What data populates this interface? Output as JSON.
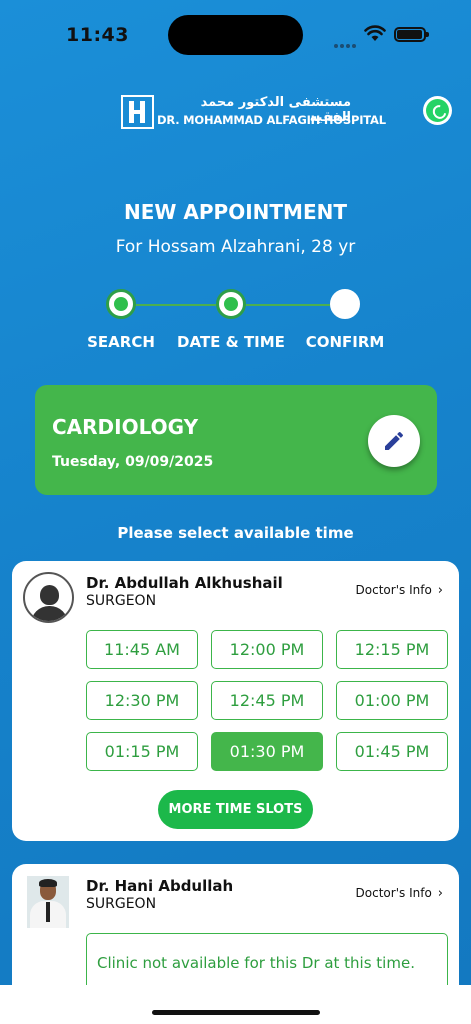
{
  "status": {
    "time": "11:43"
  },
  "logo": {
    "arabic": "مستشفى الدكتور محمد الفقيه",
    "english": "DR. MOHAMMAD ALFAGIH HOSPITAL"
  },
  "header": {
    "title": "NEW APPOINTMENT",
    "subtitle": "For Hossam Alzahrani, 28 yr"
  },
  "steps": [
    {
      "label": "SEARCH",
      "state": "done"
    },
    {
      "label": "DATE & TIME",
      "state": "done"
    },
    {
      "label": "CONFIRM",
      "state": "pending"
    }
  ],
  "specialty": {
    "name": "CARDIOLOGY",
    "date": "Tuesday, 09/09/2025"
  },
  "prompt": "Please select available time",
  "doctors": [
    {
      "name": "Dr. Abdullah Alkhushail",
      "role": "SURGEON",
      "info_label": "Doctor's Info",
      "slots": [
        "11:45 AM",
        "12:00 PM",
        "12:15 PM",
        "12:30 PM",
        "12:45 PM",
        "01:00 PM",
        "01:15 PM",
        "01:30 PM",
        "01:45 PM"
      ],
      "selected_slot": "01:30 PM",
      "more_label": "MORE TIME SLOTS"
    },
    {
      "name": "Dr. Hani Abdullah",
      "role": "SURGEON",
      "info_label": "Doctor's Info",
      "notice": "Clinic not available for this Dr at this time."
    }
  ],
  "colors": {
    "background": "#1683cc",
    "accent_green": "#44b64b",
    "button_green": "#1cb84a"
  }
}
